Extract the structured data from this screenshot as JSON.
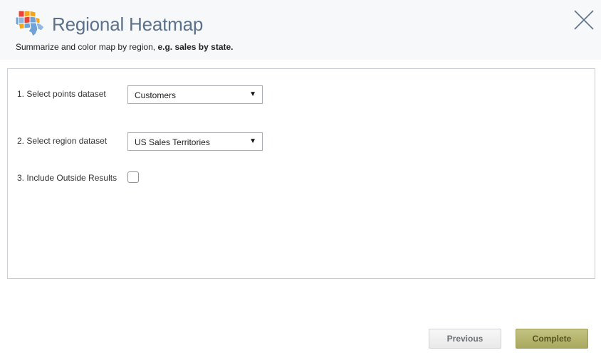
{
  "dialog": {
    "title": "Regional Heatmap",
    "subtitle_text": "Summarize and color map by region,",
    "subtitle_emphasis": "e.g. sales by state."
  },
  "icons": {
    "header": "regional-map-icon",
    "close": "close-x-icon",
    "dropdown": "caret-down-icon"
  },
  "form": {
    "points_dataset": {
      "label": "1. Select points dataset",
      "value": "Customers"
    },
    "region_dataset": {
      "label": "2. Select region dataset",
      "value": "US Sales Territories"
    },
    "include_outside": {
      "label": "3. Include Outside Results",
      "checked": false
    },
    "caret": "▼"
  },
  "buttons": {
    "previous": "Previous",
    "complete": "Complete"
  },
  "colors": {
    "header_bg": "#f6f8fa",
    "title": "#5c7189",
    "complete_bg": "#b5b46e"
  }
}
